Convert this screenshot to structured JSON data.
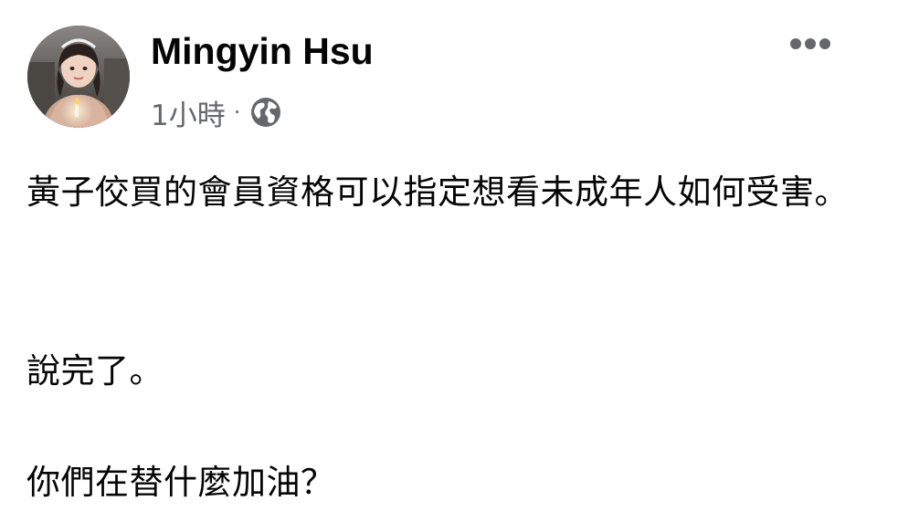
{
  "post": {
    "author": {
      "name": "Mingyin Hsu",
      "avatar_icon": "profile-photo"
    },
    "timestamp": "1小時",
    "separator": "·",
    "privacy_icon": "globe-icon",
    "more_icon": "more-horizontal-icon",
    "paragraphs": [
      "黃子佼買的會員資格可以指定想看未成年人如何受害。",
      "說完了。",
      "你們在替什麼加油？"
    ]
  },
  "colors": {
    "text_primary": "#050505",
    "text_secondary": "#65676b",
    "icon_gray": "#65676b",
    "background": "#ffffff"
  }
}
